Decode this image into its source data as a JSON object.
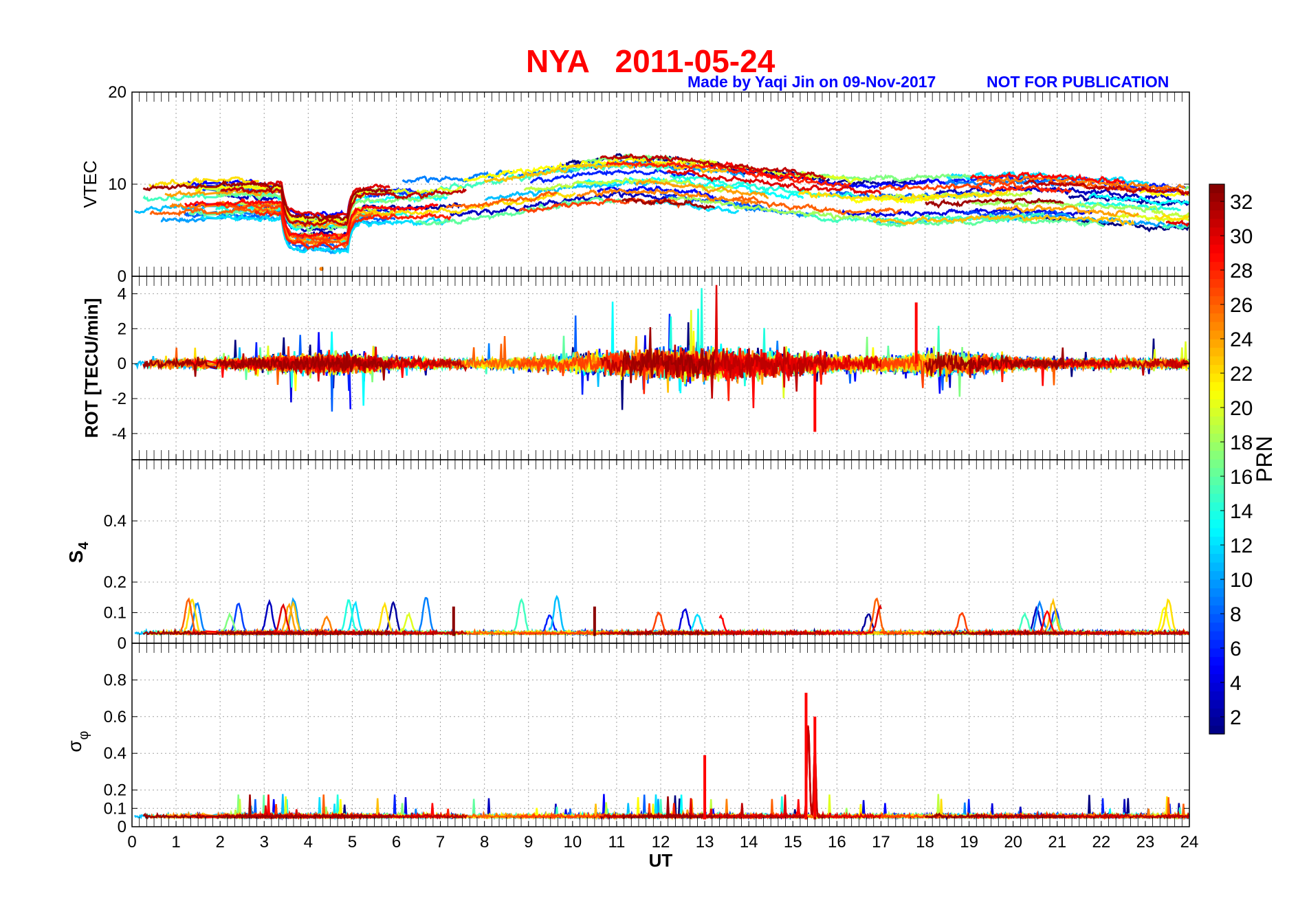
{
  "figure": {
    "title": "NYA   2011-05-24",
    "credit": "Made by Yaqi Jin on 09-Nov-2017",
    "notice": "NOT FOR PUBLICATION",
    "colors": {
      "title": "#ff0000",
      "credit": "#0000ff",
      "grid": "#a0a0a0"
    }
  },
  "chart_data": [
    {
      "type": "line",
      "panel": "vtec",
      "ylabel": "VTEC",
      "ylim": [
        0,
        20
      ],
      "yticks": [
        "0",
        "10",
        "20"
      ],
      "xlim": [
        0,
        24
      ],
      "typical_range": [
        5,
        13
      ],
      "notable": [
        {
          "x": 4.3,
          "y": 0.8,
          "note": "minimum near 4 UT"
        }
      ]
    },
    {
      "type": "line",
      "panel": "rot",
      "ylabel": "ROT [TECU/min]",
      "ylim": [
        -5.5,
        5
      ],
      "yticks": [
        "-4",
        "-2",
        "0",
        "2",
        "4"
      ],
      "xlim": [
        0,
        24
      ],
      "notable": [
        {
          "x": 15.5,
          "y": -3.9
        },
        {
          "x": 17.8,
          "y": 3.5
        }
      ]
    },
    {
      "type": "line",
      "panel": "s4",
      "ylabel": "S",
      "ylabel_sub": "4",
      "ylim": [
        0,
        0.6
      ],
      "yticks": [
        "0",
        "0.1",
        "0.2",
        "0.4"
      ],
      "xlim": [
        0,
        24
      ],
      "notable": [
        {
          "x": 7.3,
          "y": 0.12
        },
        {
          "x": 10.5,
          "y": 0.12
        }
      ]
    },
    {
      "type": "line",
      "panel": "sigma_phi",
      "ylabel": "σ",
      "ylabel_sub": "φ",
      "ylim": [
        0,
        1
      ],
      "yticks": [
        "0",
        "0.1",
        "0.2",
        "0.4",
        "0.6",
        "0.8"
      ],
      "xlim": [
        0,
        24
      ],
      "xlabel": "UT",
      "xticks": [
        "0",
        "1",
        "2",
        "3",
        "4",
        "5",
        "6",
        "7",
        "8",
        "9",
        "10",
        "11",
        "12",
        "13",
        "14",
        "15",
        "16",
        "17",
        "18",
        "19",
        "20",
        "21",
        "22",
        "23",
        "24"
      ],
      "notable": [
        {
          "x": 15.3,
          "y": 0.73
        },
        {
          "x": 15.5,
          "y": 0.6
        },
        {
          "x": 13.0,
          "y": 0.39
        }
      ]
    }
  ],
  "colorbar": {
    "label": "PRN",
    "range": [
      1,
      33
    ],
    "ticks": [
      "2",
      "4",
      "6",
      "8",
      "10",
      "12",
      "14",
      "16",
      "18",
      "20",
      "22",
      "24",
      "26",
      "28",
      "30",
      "32"
    ],
    "colormap": "jet"
  }
}
